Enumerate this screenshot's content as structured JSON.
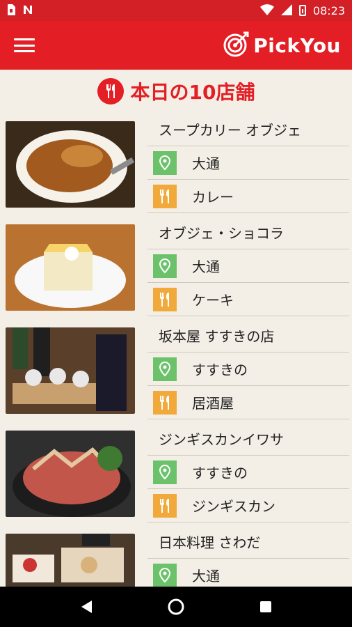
{
  "status": {
    "time": "08:23"
  },
  "app": {
    "logo_text": "PickYou"
  },
  "section": {
    "title": "本日の10店舗"
  },
  "restaurants": [
    {
      "name": "スープカリー オブジェ",
      "area": "大通",
      "genre": "カレー"
    },
    {
      "name": "オブジェ・ショコラ",
      "area": "大通",
      "genre": "ケーキ"
    },
    {
      "name": "坂本屋 すすきの店",
      "area": "すすきの",
      "genre": "居酒屋"
    },
    {
      "name": "ジンギスカンイワサ",
      "area": "すすきの",
      "genre": "ジンギスカン"
    },
    {
      "name": "日本料理 さわだ",
      "area": "大通",
      "genre": ""
    }
  ],
  "colors": {
    "brand": "#e31e24",
    "area_icon": "#6cc26b",
    "genre_icon": "#f0a93a"
  },
  "icons": {
    "menu": "hamburger-icon",
    "area": "pin-icon",
    "genre": "fork-knife-icon"
  }
}
